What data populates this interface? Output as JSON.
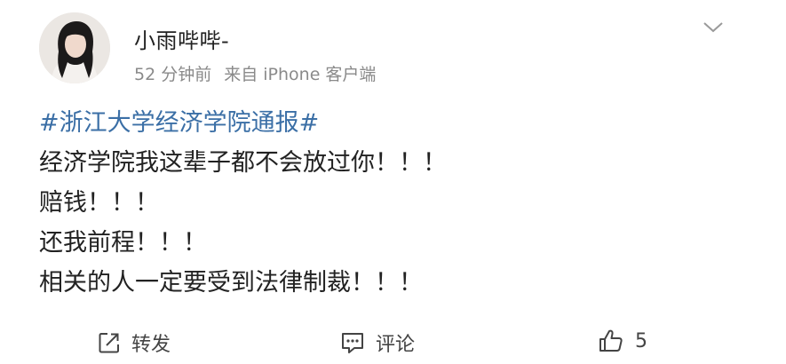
{
  "post": {
    "author": {
      "name": "小雨哔哔-",
      "avatar_icon": "user-avatar-photo"
    },
    "meta": {
      "time": "52 分钟前",
      "source": "来自 iPhone 客户端"
    },
    "menu_icon": "chevron-down-icon",
    "content": {
      "hashtag": "#浙江大学经济学院通报#",
      "lines": [
        "经济学院我这辈子都不会放过你！！！",
        "赔钱！！！",
        "还我前程！！！",
        "相关的人一定要受到法律制裁！！！"
      ]
    },
    "actions": {
      "repost_label": "转发",
      "comment_label": "评论",
      "like_count": "5"
    }
  },
  "colors": {
    "hashtag": "#3b6fa6",
    "meta_text": "#8a8a8a",
    "body_text": "#222222"
  }
}
